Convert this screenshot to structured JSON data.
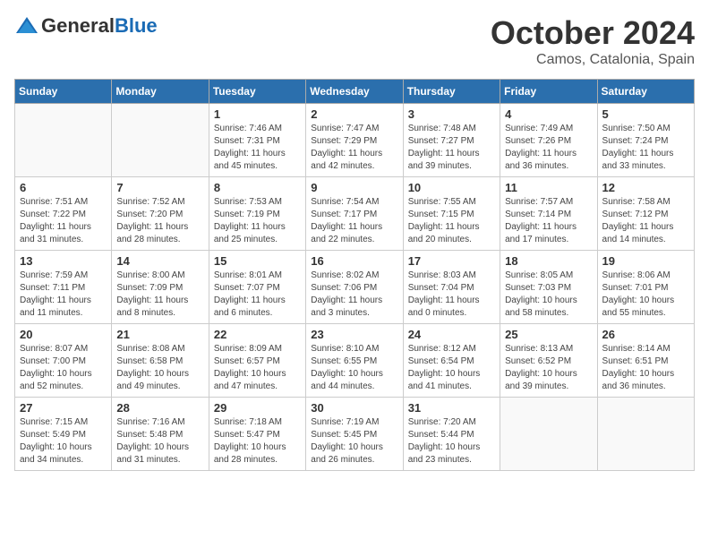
{
  "header": {
    "logo_general": "General",
    "logo_blue": "Blue",
    "month": "October 2024",
    "location": "Camos, Catalonia, Spain"
  },
  "weekdays": [
    "Sunday",
    "Monday",
    "Tuesday",
    "Wednesday",
    "Thursday",
    "Friday",
    "Saturday"
  ],
  "weeks": [
    [
      {
        "day": "",
        "info": ""
      },
      {
        "day": "",
        "info": ""
      },
      {
        "day": "1",
        "info": "Sunrise: 7:46 AM\nSunset: 7:31 PM\nDaylight: 11 hours and 45 minutes."
      },
      {
        "day": "2",
        "info": "Sunrise: 7:47 AM\nSunset: 7:29 PM\nDaylight: 11 hours and 42 minutes."
      },
      {
        "day": "3",
        "info": "Sunrise: 7:48 AM\nSunset: 7:27 PM\nDaylight: 11 hours and 39 minutes."
      },
      {
        "day": "4",
        "info": "Sunrise: 7:49 AM\nSunset: 7:26 PM\nDaylight: 11 hours and 36 minutes."
      },
      {
        "day": "5",
        "info": "Sunrise: 7:50 AM\nSunset: 7:24 PM\nDaylight: 11 hours and 33 minutes."
      }
    ],
    [
      {
        "day": "6",
        "info": "Sunrise: 7:51 AM\nSunset: 7:22 PM\nDaylight: 11 hours and 31 minutes."
      },
      {
        "day": "7",
        "info": "Sunrise: 7:52 AM\nSunset: 7:20 PM\nDaylight: 11 hours and 28 minutes."
      },
      {
        "day": "8",
        "info": "Sunrise: 7:53 AM\nSunset: 7:19 PM\nDaylight: 11 hours and 25 minutes."
      },
      {
        "day": "9",
        "info": "Sunrise: 7:54 AM\nSunset: 7:17 PM\nDaylight: 11 hours and 22 minutes."
      },
      {
        "day": "10",
        "info": "Sunrise: 7:55 AM\nSunset: 7:15 PM\nDaylight: 11 hours and 20 minutes."
      },
      {
        "day": "11",
        "info": "Sunrise: 7:57 AM\nSunset: 7:14 PM\nDaylight: 11 hours and 17 minutes."
      },
      {
        "day": "12",
        "info": "Sunrise: 7:58 AM\nSunset: 7:12 PM\nDaylight: 11 hours and 14 minutes."
      }
    ],
    [
      {
        "day": "13",
        "info": "Sunrise: 7:59 AM\nSunset: 7:11 PM\nDaylight: 11 hours and 11 minutes."
      },
      {
        "day": "14",
        "info": "Sunrise: 8:00 AM\nSunset: 7:09 PM\nDaylight: 11 hours and 8 minutes."
      },
      {
        "day": "15",
        "info": "Sunrise: 8:01 AM\nSunset: 7:07 PM\nDaylight: 11 hours and 6 minutes."
      },
      {
        "day": "16",
        "info": "Sunrise: 8:02 AM\nSunset: 7:06 PM\nDaylight: 11 hours and 3 minutes."
      },
      {
        "day": "17",
        "info": "Sunrise: 8:03 AM\nSunset: 7:04 PM\nDaylight: 11 hours and 0 minutes."
      },
      {
        "day": "18",
        "info": "Sunrise: 8:05 AM\nSunset: 7:03 PM\nDaylight: 10 hours and 58 minutes."
      },
      {
        "day": "19",
        "info": "Sunrise: 8:06 AM\nSunset: 7:01 PM\nDaylight: 10 hours and 55 minutes."
      }
    ],
    [
      {
        "day": "20",
        "info": "Sunrise: 8:07 AM\nSunset: 7:00 PM\nDaylight: 10 hours and 52 minutes."
      },
      {
        "day": "21",
        "info": "Sunrise: 8:08 AM\nSunset: 6:58 PM\nDaylight: 10 hours and 49 minutes."
      },
      {
        "day": "22",
        "info": "Sunrise: 8:09 AM\nSunset: 6:57 PM\nDaylight: 10 hours and 47 minutes."
      },
      {
        "day": "23",
        "info": "Sunrise: 8:10 AM\nSunset: 6:55 PM\nDaylight: 10 hours and 44 minutes."
      },
      {
        "day": "24",
        "info": "Sunrise: 8:12 AM\nSunset: 6:54 PM\nDaylight: 10 hours and 41 minutes."
      },
      {
        "day": "25",
        "info": "Sunrise: 8:13 AM\nSunset: 6:52 PM\nDaylight: 10 hours and 39 minutes."
      },
      {
        "day": "26",
        "info": "Sunrise: 8:14 AM\nSunset: 6:51 PM\nDaylight: 10 hours and 36 minutes."
      }
    ],
    [
      {
        "day": "27",
        "info": "Sunrise: 7:15 AM\nSunset: 5:49 PM\nDaylight: 10 hours and 34 minutes."
      },
      {
        "day": "28",
        "info": "Sunrise: 7:16 AM\nSunset: 5:48 PM\nDaylight: 10 hours and 31 minutes."
      },
      {
        "day": "29",
        "info": "Sunrise: 7:18 AM\nSunset: 5:47 PM\nDaylight: 10 hours and 28 minutes."
      },
      {
        "day": "30",
        "info": "Sunrise: 7:19 AM\nSunset: 5:45 PM\nDaylight: 10 hours and 26 minutes."
      },
      {
        "day": "31",
        "info": "Sunrise: 7:20 AM\nSunset: 5:44 PM\nDaylight: 10 hours and 23 minutes."
      },
      {
        "day": "",
        "info": ""
      },
      {
        "day": "",
        "info": ""
      }
    ]
  ]
}
